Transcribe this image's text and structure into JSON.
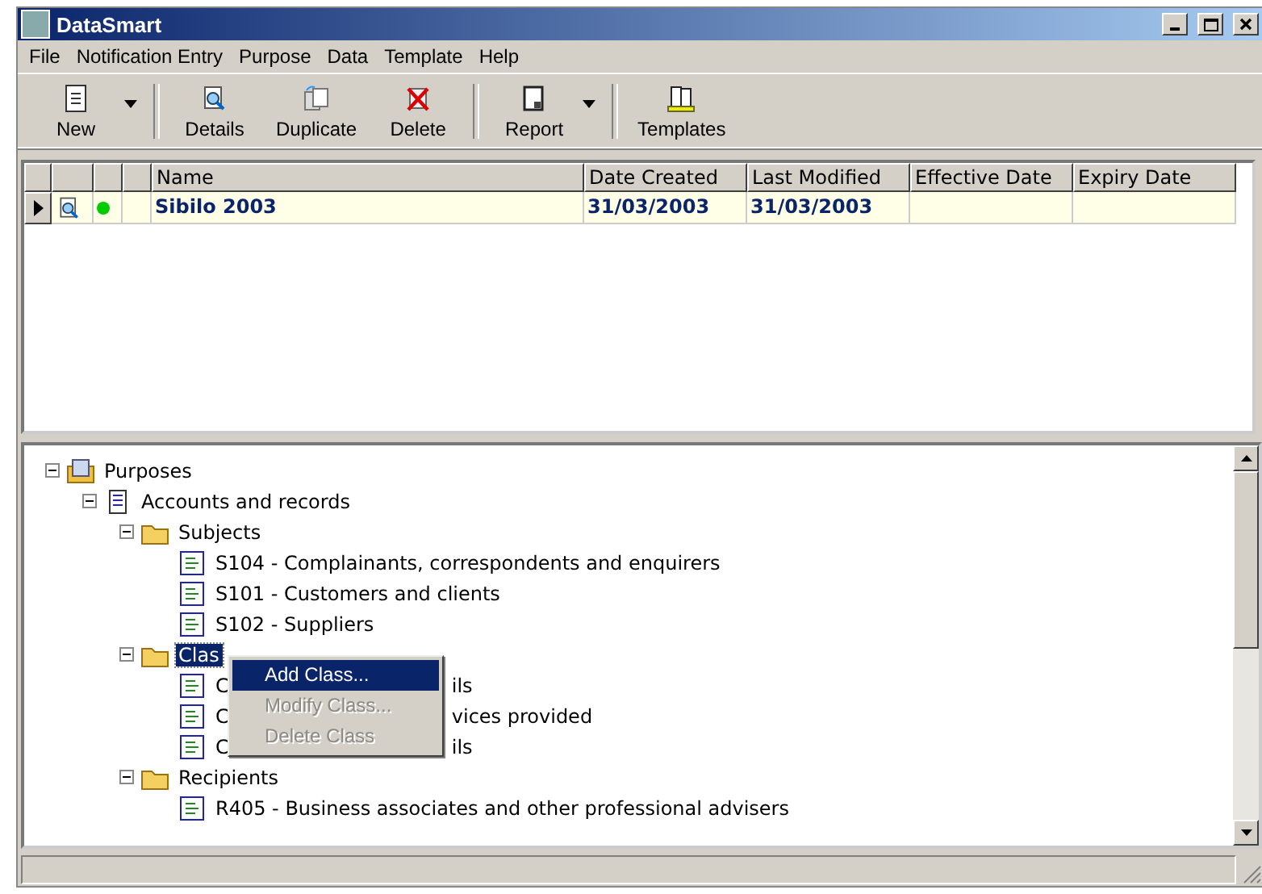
{
  "window": {
    "title": "DataSmart"
  },
  "menu_bar": [
    "File",
    "Notification Entry",
    "Purpose",
    "Data",
    "Template",
    "Help"
  ],
  "toolbar": [
    {
      "label": "New",
      "kind": "new",
      "dropdown": true
    },
    {
      "kind": "separator"
    },
    {
      "label": "Details",
      "kind": "details",
      "dropdown": false
    },
    {
      "label": "Duplicate",
      "kind": "duplicate",
      "dropdown": false
    },
    {
      "label": "Delete",
      "kind": "delete",
      "dropdown": false
    },
    {
      "kind": "separator"
    },
    {
      "label": "Report",
      "kind": "report",
      "dropdown": true
    },
    {
      "kind": "separator"
    },
    {
      "label": "Templates",
      "kind": "templates",
      "dropdown": false
    }
  ],
  "table": {
    "columns": [
      "Name",
      "Date Created",
      "Last Modified",
      "Effective Date",
      "Expiry Date"
    ],
    "rows": [
      {
        "current": true,
        "color": "#00cc00",
        "cells": [
          "Sibilo 2003",
          "31/03/2003",
          "31/03/2003",
          "",
          ""
        ]
      }
    ]
  },
  "tree": [
    {
      "label": "Purposes",
      "kind": "root",
      "expanded": true,
      "selected": false,
      "children": [
        {
          "label": "Accounts and records",
          "kind": "document",
          "expanded": true,
          "selected": false,
          "children": [
            {
              "label": "Subjects",
              "kind": "folder",
              "expanded": true,
              "selected": false,
              "children": [
                {
                  "label": "S104 - Complainants, correspondents and enquirers",
                  "kind": "item",
                  "selected": false
                },
                {
                  "label": "S101 - Customers and clients",
                  "kind": "item",
                  "selected": false
                },
                {
                  "label": "S102 - Suppliers",
                  "kind": "item",
                  "selected": false
                }
              ]
            },
            {
              "label": "Clas",
              "kind": "folder",
              "expanded": true,
              "selected": true,
              "children": [
                {
                  "label": "C",
                  "label_tail": "ils",
                  "kind": "item",
                  "selected": false
                },
                {
                  "label": "C",
                  "label_tail": "vices provided",
                  "kind": "item",
                  "selected": false
                },
                {
                  "label": "C",
                  "label_tail": "ils",
                  "kind": "item",
                  "selected": false
                }
              ]
            },
            {
              "label": "Recipients",
              "kind": "folder",
              "expanded": true,
              "selected": false,
              "children": [
                {
                  "label": "R405 - Business associates and other professional advisers",
                  "kind": "item",
                  "selected": false
                }
              ]
            }
          ]
        }
      ]
    }
  ],
  "context_menu": [
    {
      "label": "Add Class...",
      "selected": true,
      "disabled": false
    },
    {
      "label": "Modify Class...",
      "selected": false,
      "disabled": true
    },
    {
      "label": "Delete Class",
      "selected": false,
      "disabled": true
    }
  ]
}
